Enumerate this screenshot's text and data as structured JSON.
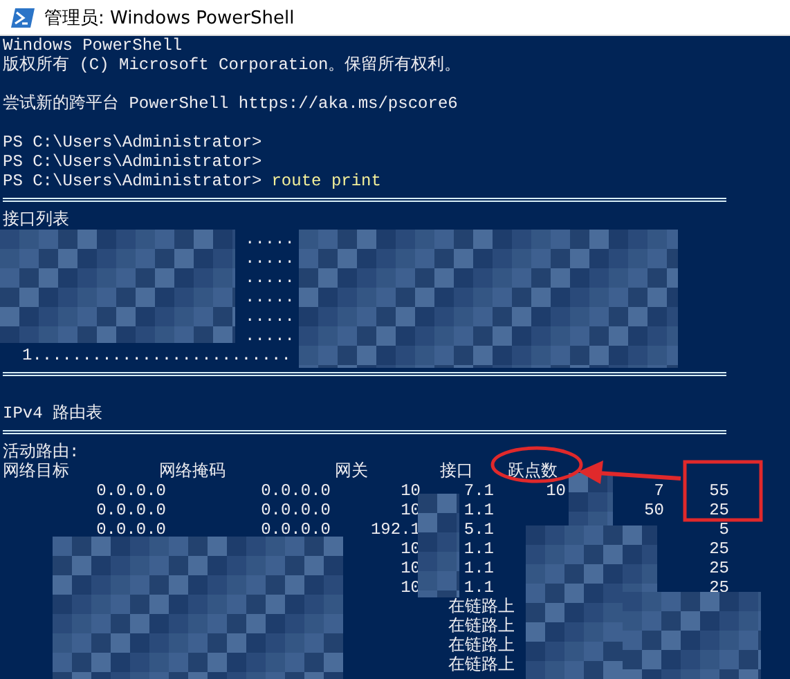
{
  "window": {
    "title": "管理员: Windows PowerShell"
  },
  "console": {
    "banner": [
      "Windows PowerShell",
      "版权所有 (C) Microsoft Corporation。保留所有权利。"
    ],
    "hint": "尝试新的跨平台 PowerShell https://aka.ms/pscore6",
    "prompts": [
      {
        "prompt": "PS C:\\Users\\Administrator>"
      },
      {
        "prompt": "PS C:\\Users\\Administrator>"
      },
      {
        "prompt": "PS C:\\Users\\Administrator>",
        "command": "route print"
      }
    ],
    "interface_list": {
      "title": "接口列表",
      "rows": [
        ".....",
        ".....",
        ".....",
        ".....",
        ".....",
        ".....",
        "1.........................."
      ]
    },
    "ipv4_table": {
      "title": "IPv4 路由表",
      "active_routes": "活动路由:",
      "columns": [
        "网络目标",
        "网络掩码",
        "网关",
        "接口",
        "跃点数"
      ],
      "rows": [
        {
          "destination": "0.0.0.0",
          "netmask": "0.0.0.0",
          "gateway": "10",
          "interface": "7.1",
          "column_5": "10",
          "column_6": "7",
          "metric": "55"
        },
        {
          "destination": "0.0.0.0",
          "netmask": "0.0.0.0",
          "gateway": "10",
          "interface": "1.1",
          "column_6": "50",
          "metric": "25"
        },
        {
          "destination": "0.0.0.0",
          "netmask": "0.0.0.0",
          "gateway": "192.1",
          "interface": "5.1",
          "metric": "5"
        },
        {
          "gateway": "10",
          "interface": "1.1",
          "metric": "25"
        },
        {
          "gateway": "10",
          "interface": "1.1",
          "metric": "25"
        },
        {
          "gateway": "10",
          "interface": "1.1",
          "metric": "25"
        }
      ],
      "on_link": [
        "在链路上",
        "在链路上",
        "在链路上",
        "在链路上"
      ]
    }
  }
}
